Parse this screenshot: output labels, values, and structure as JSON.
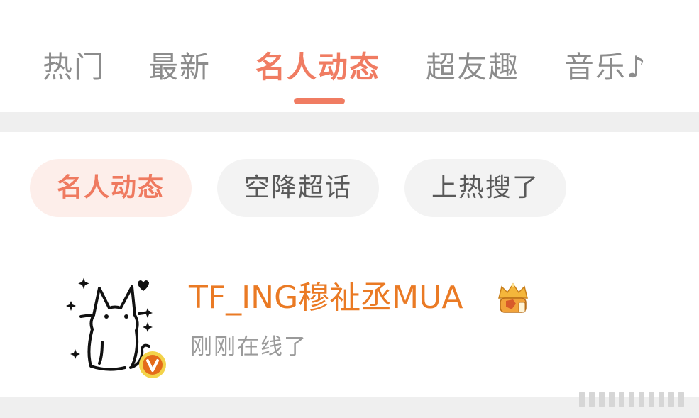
{
  "tabs": {
    "items": [
      {
        "label": "热门",
        "active": false
      },
      {
        "label": "最新",
        "active": false
      },
      {
        "label": "名人动态",
        "active": true
      },
      {
        "label": "超友趣",
        "active": false
      },
      {
        "label": "音乐♪",
        "active": false
      }
    ]
  },
  "filters": {
    "items": [
      {
        "label": "名人动态",
        "active": true
      },
      {
        "label": "空降超话",
        "active": false
      },
      {
        "label": "上热搜了",
        "active": false
      }
    ]
  },
  "feed": {
    "item": {
      "username": "TF_ING穆祉丞MUA",
      "status": "刚刚在线了",
      "avatar_icon": "cat-doodle-avatar",
      "badge_icon": "verified-v-icon",
      "crown_icon": "gold-crown-badge-icon"
    }
  },
  "colors": {
    "accent": "#f07c62",
    "username": "#ea7a24",
    "inactive_tab": "#8c8c8c",
    "pill_bg": "#f3f3f3",
    "pill_active_bg": "#fdeeea",
    "divider": "#efefef"
  }
}
